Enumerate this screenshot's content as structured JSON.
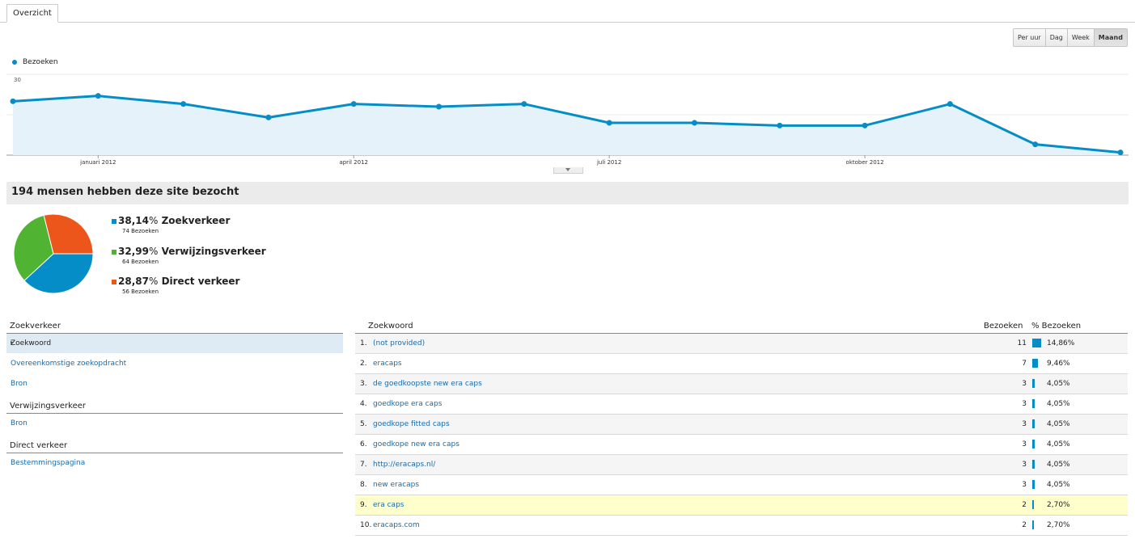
{
  "tabs": [
    {
      "label": "Overzicht"
    }
  ],
  "period_buttons": [
    {
      "label": "Per uur",
      "active": false
    },
    {
      "label": "Dag",
      "active": false
    },
    {
      "label": "Week",
      "active": false
    },
    {
      "label": "Maand",
      "active": true
    }
  ],
  "chart_data": {
    "type": "area",
    "series": [
      {
        "name": "Bezoeken",
        "color": "#058dc7",
        "values": [
          20,
          22,
          19,
          14,
          19,
          18,
          19,
          12,
          12,
          11,
          11,
          19,
          4,
          1
        ]
      }
    ],
    "ylim": [
      0,
      30
    ],
    "y_ticks": [
      "30",
      "15"
    ],
    "x_tick_labels": [
      {
        "label": "januari 2012",
        "index": 1
      },
      {
        "label": "april 2012",
        "index": 4
      },
      {
        "label": "juli 2012",
        "index": 7
      },
      {
        "label": "oktober 2012",
        "index": 10
      }
    ],
    "grid": true,
    "legend": "top-left"
  },
  "summary": {
    "title": "194 mensen hebben deze site bezocht"
  },
  "pie": {
    "type": "pie",
    "slices": [
      {
        "label": "Zoekverkeer",
        "pct": "38,14",
        "value": 38.14,
        "visits": "74 Bezoeken",
        "color": "#058dc7"
      },
      {
        "label": "Verwijzingsverkeer",
        "pct": "32,99",
        "value": 32.99,
        "visits": "64 Bezoeken",
        "color": "#50b432"
      },
      {
        "label": "Direct verkeer",
        "pct": "28,87",
        "value": 28.87,
        "visits": "56 Bezoeken",
        "color": "#ed561b"
      }
    ]
  },
  "left_nav": {
    "sections": [
      {
        "heading": "Zoekverkeer",
        "items": [
          {
            "label": "Zoekwoord",
            "selected": true
          },
          {
            "label": "Overeenkomstige zoekopdracht",
            "selected": false
          },
          {
            "label": "Bron",
            "selected": false
          }
        ]
      },
      {
        "heading": "Verwijzingsverkeer",
        "items": [
          {
            "label": "Bron",
            "selected": false
          }
        ]
      },
      {
        "heading": "Direct verkeer",
        "items": [
          {
            "label": "Bestemmingspagina",
            "selected": false
          }
        ]
      }
    ]
  },
  "table": {
    "headers": {
      "keyword": "Zoekwoord",
      "visits": "Bezoeken",
      "pct": "% Bezoeken"
    },
    "rows": [
      {
        "num": "1.",
        "keyword": "(not provided)",
        "visits": "11",
        "pct": "14,86%",
        "share": 14.86,
        "highlight": false
      },
      {
        "num": "2.",
        "keyword": "eracaps",
        "visits": "7",
        "pct": "9,46%",
        "share": 9.46,
        "highlight": false
      },
      {
        "num": "3.",
        "keyword": "de goedkoopste new era caps",
        "visits": "3",
        "pct": "4,05%",
        "share": 4.05,
        "highlight": false
      },
      {
        "num": "4.",
        "keyword": "goedkope era caps",
        "visits": "3",
        "pct": "4,05%",
        "share": 4.05,
        "highlight": false
      },
      {
        "num": "5.",
        "keyword": "goedkope fitted caps",
        "visits": "3",
        "pct": "4,05%",
        "share": 4.05,
        "highlight": false
      },
      {
        "num": "6.",
        "keyword": "goedkope new era caps",
        "visits": "3",
        "pct": "4,05%",
        "share": 4.05,
        "highlight": false
      },
      {
        "num": "7.",
        "keyword": "http://eracaps.nl/",
        "visits": "3",
        "pct": "4,05%",
        "share": 4.05,
        "highlight": false
      },
      {
        "num": "8.",
        "keyword": "new eracaps",
        "visits": "3",
        "pct": "4,05%",
        "share": 4.05,
        "highlight": false
      },
      {
        "num": "9.",
        "keyword": "era caps",
        "visits": "2",
        "pct": "2,70%",
        "share": 2.7,
        "highlight": true
      },
      {
        "num": "10.",
        "keyword": "eracaps.com",
        "visits": "2",
        "pct": "2,70%",
        "share": 2.7,
        "highlight": false
      }
    ]
  }
}
